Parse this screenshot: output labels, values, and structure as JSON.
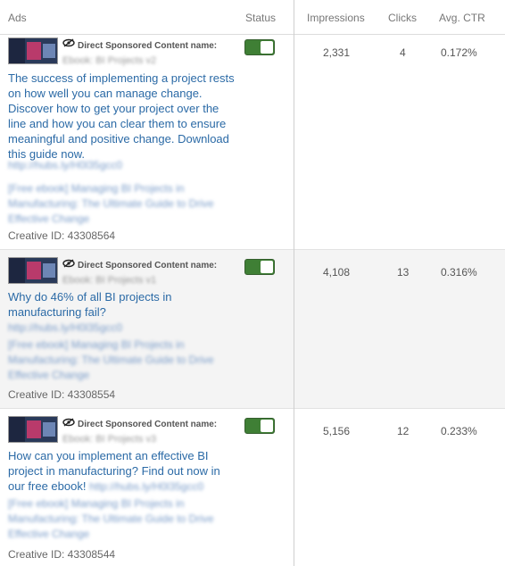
{
  "headers": {
    "ads": "Ads",
    "status": "Status",
    "impressions": "Impressions",
    "clicks": "Clicks",
    "ctr": "Avg. CTR"
  },
  "rows": [
    {
      "type_label": "Direct Sponsored Content name:",
      "name": "Ebook: BI Projects v2",
      "intro": "The success of implementing a project rests on how well you can manage change. Discover how to get your project over the line and how you can clear them to ensure meaningful and positive change. Download this guide now.",
      "link": "http://hubs.ly/H0l35gcc0",
      "headline": "[Free ebook] Managing BI Projects in Manufacturing: The Ultimate Guide to Drive Effective Change",
      "creative_id": "Creative ID: 43308564",
      "status_on": true,
      "impressions": "2,331",
      "clicks": "4",
      "ctr": "0.172%"
    },
    {
      "type_label": "Direct Sponsored Content name:",
      "name": "Ebook: BI Projects v1",
      "intro": "Why do 46% of all BI projects in manufacturing fail?",
      "link": "http://hubs.ly/H0l35gcc0",
      "headline": "[Free ebook] Managing BI Projects in Manufacturing: The Ultimate Guide to Drive Effective Change",
      "creative_id": "Creative ID: 43308554",
      "status_on": true,
      "impressions": "4,108",
      "clicks": "13",
      "ctr": "0.316%"
    },
    {
      "type_label": "Direct Sponsored Content name:",
      "name": "Ebook: BI Projects v3",
      "intro": "How can you implement an effective BI project in manufacturing? Find out now in our free ebook!",
      "link": "http://hubs.ly/H0l35gcc0",
      "headline": "[Free ebook] Managing BI Projects in Manufacturing: The Ultimate Guide to Drive Effective Change",
      "creative_id": "Creative ID: 43308544",
      "status_on": true,
      "impressions": "5,156",
      "clicks": "12",
      "ctr": "0.233%"
    }
  ],
  "icons": {
    "visibility": "eye-slash-icon"
  },
  "colors": {
    "toggle_on": "#3f7f35",
    "link": "#2b6aa6",
    "row_alt": "#f4f4f4"
  }
}
